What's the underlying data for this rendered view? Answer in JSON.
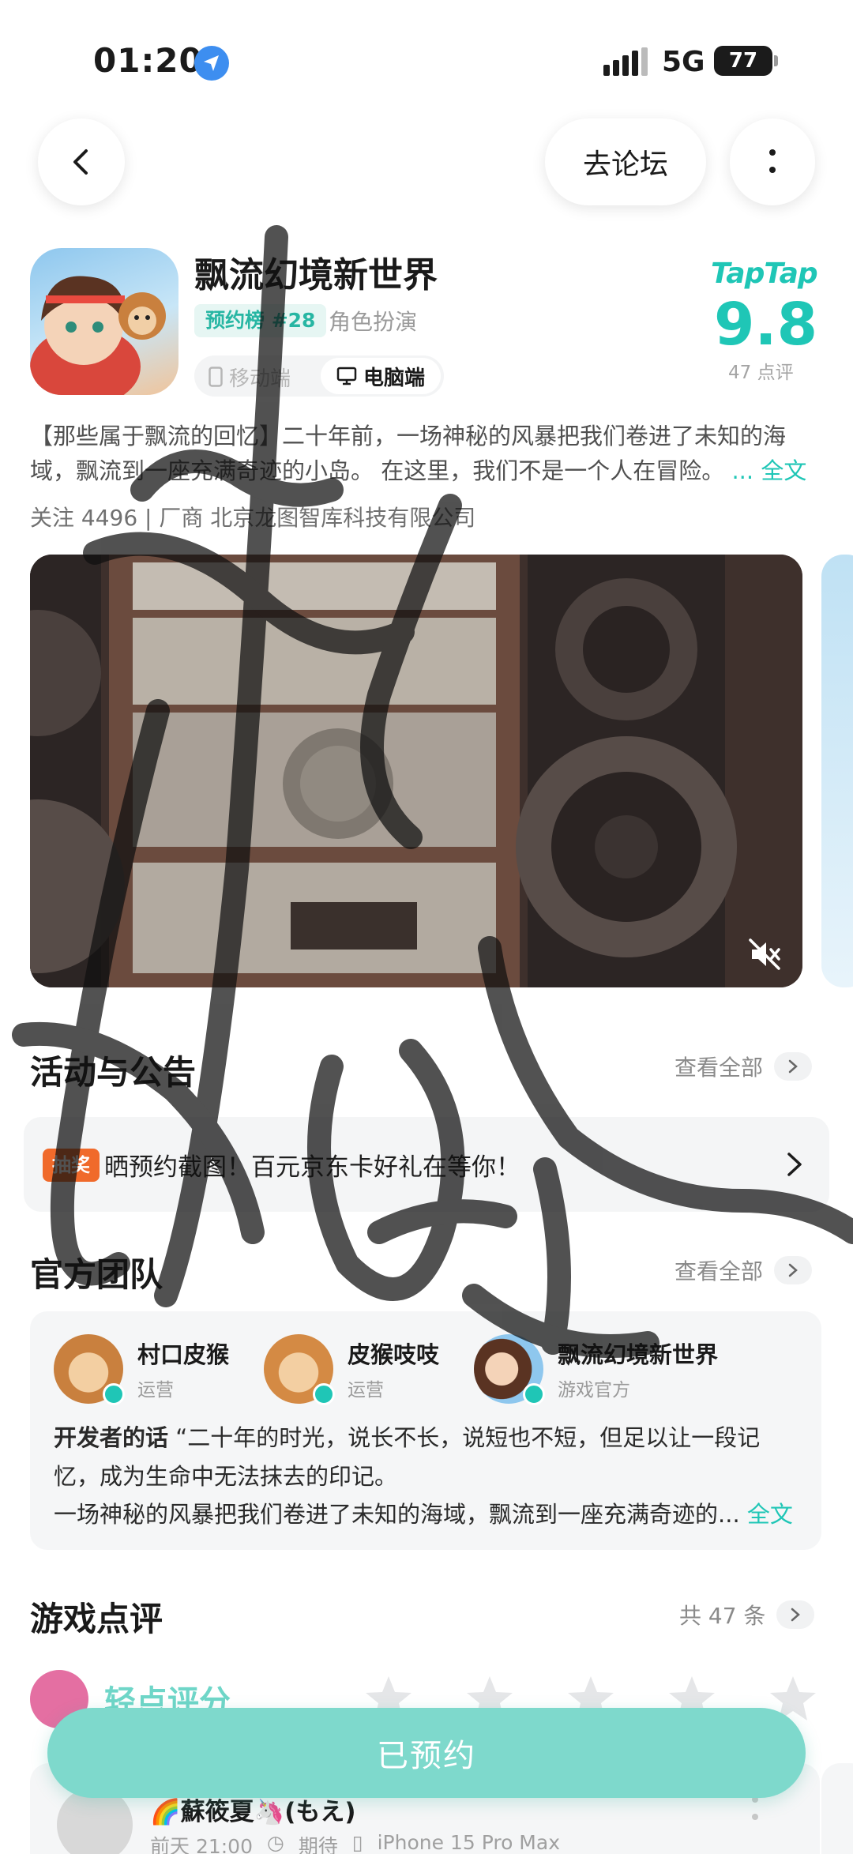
{
  "status_bar": {
    "time": "01:20",
    "network": "5G",
    "battery": "77"
  },
  "header": {
    "forum_label": "去论坛"
  },
  "app": {
    "title": "飘流幻境新世界",
    "rank_badge": "预约榜 #28",
    "genre": "角色扮演",
    "platform_mobile": "移动端",
    "platform_pc": "电脑端",
    "platform_selected": "电脑端",
    "rating_brand": "TapTap",
    "score": "9.8",
    "review_count_label": "47 点评",
    "description": "【那些属于飘流的回忆】二十年前，一场神秘的风暴把我们卷进了未知的海域，飘流到一座充满奇迹的小岛。  在这里，我们不是一个人在冒险。",
    "fulltext_label": "... 全文",
    "follow_line": "关注 4496  |  厂商 北京龙图智库科技有限公司"
  },
  "activity": {
    "title": "活动与公告",
    "see_all": "查看全部",
    "badge": "抽奖",
    "text": "晒预约截图！百元京东卡好礼在等你！"
  },
  "team": {
    "title": "官方团队",
    "see_all": "查看全部",
    "members": [
      {
        "name": "村口皮猴",
        "role": "运营"
      },
      {
        "name": "皮猴吱吱",
        "role": "运营"
      },
      {
        "name": "飘流幻境新世界",
        "role": "游戏官方"
      }
    ],
    "dev_label": "开发者的话",
    "dev_quote": " “二十年的时光，说长不长，说短也不短，但足以让一段记忆，成为生命中无法抹去的印记。",
    "dev_more": "一场神秘的风暴把我们卷进了未知的海域，飘流到一座充满奇迹的...",
    "fulltext_label": " 全文"
  },
  "reviews": {
    "title": "游戏点评",
    "total": "共 47 条",
    "rate_label": "轻点评分",
    "stars_total": 5,
    "stars_filled": 0,
    "reviewer_name": "🌈蘇筱夏🦄(もえ)",
    "time": "前天 21:00",
    "tag": "期待",
    "device": "iPhone 15 Pro Max"
  },
  "reserve_button": {
    "label": "已预约"
  },
  "colors": {
    "accent": "#1fc6b6",
    "badge_orange": "#f06a2b",
    "reserve_bg": "#7ed9cc"
  }
}
